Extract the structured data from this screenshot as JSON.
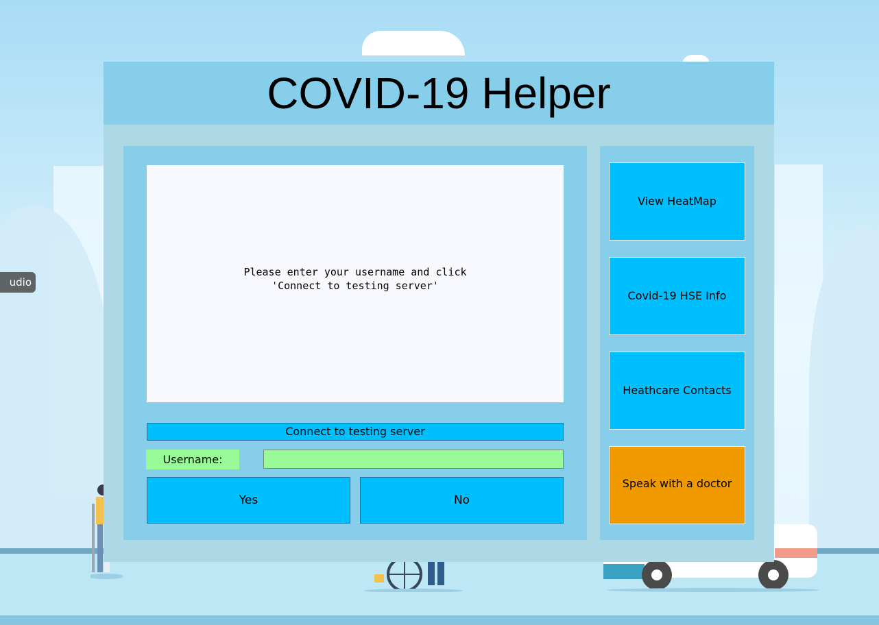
{
  "studio_tag": {
    "text": "udio"
  },
  "window": {
    "title": "COVID-19 Helper",
    "message": "Please enter your username and click\n'Connect to testing server'",
    "connect_button": "Connect to testing server",
    "username_label": "Username:",
    "username_value": "",
    "yes_button": "Yes",
    "no_button": "No",
    "side_buttons": {
      "heatmap": "View HeatMap",
      "hse_info": "Covid-19 HSE Info",
      "contacts": "Heathcare Contacts",
      "doctor": "Speak with a doctor"
    }
  },
  "colors": {
    "title_bar": "#87ceeb",
    "window_bg": "#add8e6",
    "button": "#00bfff",
    "input": "#98fb98",
    "doctor_button": "#f09a00",
    "message_bg": "#f8f8ff"
  }
}
